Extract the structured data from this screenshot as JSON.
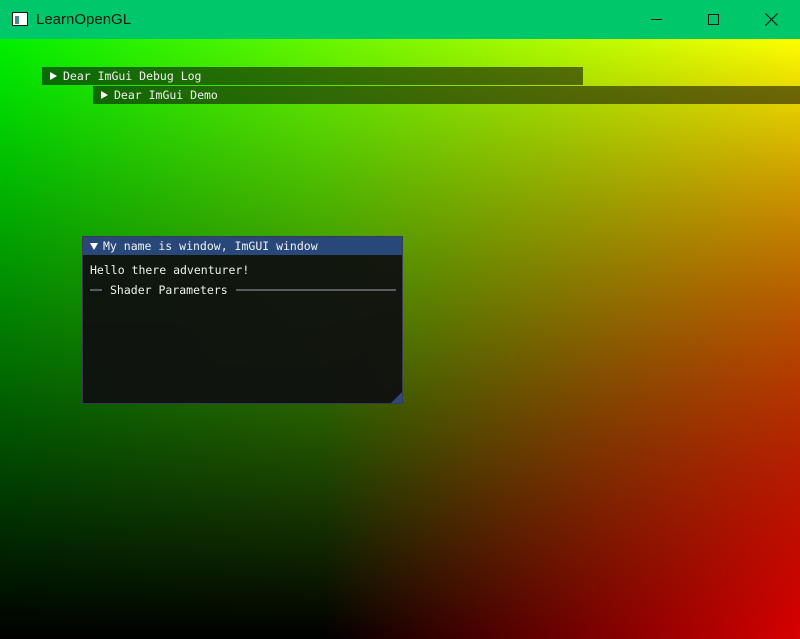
{
  "window": {
    "title": "LearnOpenGL",
    "icon": "app-window-icon",
    "controls": [
      "minimize-icon",
      "maximize-icon",
      "close-icon"
    ]
  },
  "collapsed_windows": {
    "debug_log": "Dear ImGui Debug Log",
    "demo": "Dear ImGui Demo"
  },
  "imgui_window": {
    "title": "My name is window, ImGUI window",
    "text": "Hello there adventurer!",
    "separator_label": "Shader Parameters"
  },
  "colors": {
    "titlebar": "#00c86a",
    "imgui_title_active": "#29487a",
    "gradient_top_left": "#00f000",
    "gradient_top_right": "#ffff00",
    "gradient_bottom_right": "#ff0000",
    "gradient_bottom_left": "#000000"
  }
}
